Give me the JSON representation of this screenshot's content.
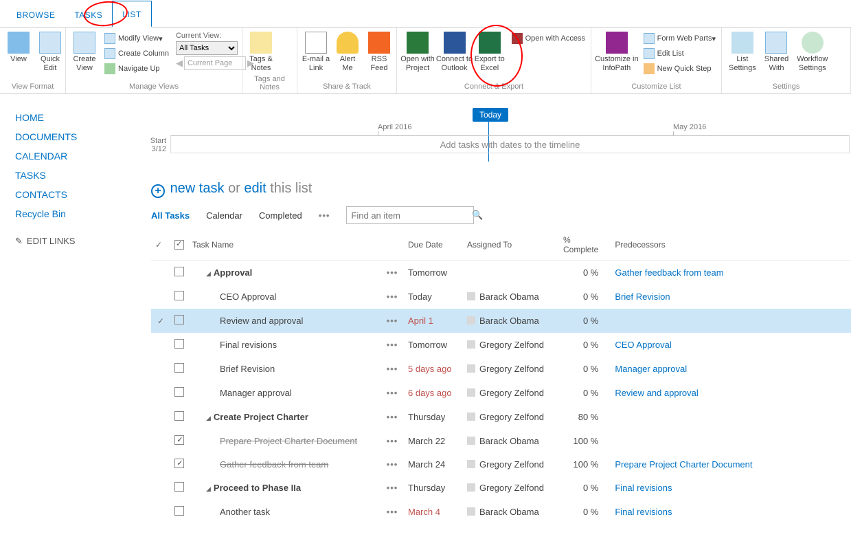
{
  "tabs": {
    "browse": "BROWSE",
    "tasks": "TASKS",
    "list": "LIST"
  },
  "ribbon": {
    "view_format": {
      "title": "View Format",
      "view": "View",
      "quick_edit": "Quick\nEdit"
    },
    "manage_views": {
      "title": "Manage Views",
      "create_view": "Create\nView",
      "modify_view": "Modify View",
      "create_column": "Create Column",
      "navigate_up": "Navigate Up",
      "current_view_lbl": "Current View:",
      "all_tasks": "All Tasks",
      "current_page": "Current Page"
    },
    "tags_notes": {
      "title": "Tags and Notes",
      "btn": "Tags &\nNotes"
    },
    "share_track": {
      "title": "Share & Track",
      "email": "E-mail a\nLink",
      "alert": "Alert\nMe",
      "rss": "RSS\nFeed"
    },
    "connect_export": {
      "title": "Connect & Export",
      "project": "Open with\nProject",
      "outlook": "Connect to\nOutlook",
      "excel": "Export to\nExcel",
      "access": "Open with Access"
    },
    "customize": {
      "title": "Customize List",
      "infopath": "Customize in\nInfoPath",
      "form_web_parts": "Form Web Parts",
      "edit_list": "Edit List",
      "new_quick_step": "New Quick Step"
    },
    "settings": {
      "title": "Settings",
      "list_settings": "List\nSettings",
      "shared_with": "Shared\nWith",
      "workflow": "Workflow\nSettings"
    }
  },
  "nav": {
    "home": "HOME",
    "documents": "DOCUMENTS",
    "calendar": "CALENDAR",
    "tasks": "TASKS",
    "contacts": "CONTACTS",
    "recycle": "Recycle Bin",
    "edit_links": "EDIT LINKS"
  },
  "timeline": {
    "today": "Today",
    "start": "Start",
    "start_date": "3/12",
    "month1": "April 2016",
    "month2": "May 2016",
    "placeholder": "Add tasks with dates to the timeline"
  },
  "newtask": {
    "new": "new task",
    "or": "or",
    "edit": "edit",
    "this_list": "this list"
  },
  "views": {
    "all": "All Tasks",
    "calendar": "Calendar",
    "completed": "Completed"
  },
  "search_placeholder": "Find an item",
  "cols": {
    "task_name": "Task Name",
    "due": "Due Date",
    "assigned": "Assigned To",
    "pct": "% Complete",
    "pred": "Predecessors"
  },
  "rows": [
    {
      "mark": false,
      "chk": false,
      "name": "Approval",
      "bold": true,
      "tri": true,
      "indent": 1,
      "due": "Tomorrow",
      "assigned": "",
      "pct": "0 %",
      "pred": "Gather feedback from team"
    },
    {
      "mark": false,
      "chk": false,
      "name": "CEO Approval",
      "indent": 2,
      "due": "Today",
      "assigned": "Barack Obama",
      "pct": "0 %",
      "pred": "Brief Revision"
    },
    {
      "mark": true,
      "chk": false,
      "name": "Review and approval",
      "indent": 2,
      "due": "April 1",
      "due_red": true,
      "assigned": "Barack Obama",
      "pct": "0 %",
      "pred": "",
      "sel": true
    },
    {
      "mark": false,
      "chk": false,
      "name": "Final revisions",
      "indent": 2,
      "due": "Tomorrow",
      "assigned": "Gregory Zelfond",
      "pct": "0 %",
      "pred": "CEO Approval"
    },
    {
      "mark": false,
      "chk": false,
      "name": "Brief Revision",
      "indent": 2,
      "due": "5 days ago",
      "due_red": true,
      "assigned": "Gregory Zelfond",
      "pct": "0 %",
      "pred": "Manager approval"
    },
    {
      "mark": false,
      "chk": false,
      "name": "Manager approval",
      "indent": 2,
      "due": "6 days ago",
      "due_red": true,
      "assigned": "Gregory Zelfond",
      "pct": "0 %",
      "pred": "Review and approval"
    },
    {
      "mark": false,
      "chk": false,
      "name": "Create Project Charter",
      "bold": true,
      "tri": true,
      "indent": 1,
      "due": "Thursday",
      "assigned": "Gregory Zelfond",
      "pct": "80 %",
      "pred": ""
    },
    {
      "mark": false,
      "chk": true,
      "name": "Prepare Project Charter Document",
      "strike": true,
      "indent": 2,
      "due": "March 22",
      "assigned": "Barack Obama",
      "pct": "100 %",
      "pred": ""
    },
    {
      "mark": false,
      "chk": true,
      "name": "Gather feedback from team",
      "strike": true,
      "indent": 2,
      "due": "March 24",
      "assigned": "Gregory Zelfond",
      "pct": "100 %",
      "pred": "Prepare Project Charter Document"
    },
    {
      "mark": false,
      "chk": false,
      "name": "Proceed to Phase IIa",
      "bold": true,
      "tri": true,
      "indent": 1,
      "due": "Thursday",
      "assigned": "Gregory Zelfond",
      "pct": "0 %",
      "pred": "Final revisions"
    },
    {
      "mark": false,
      "chk": false,
      "name": "Another task",
      "indent": 2,
      "due": "March 4",
      "due_red": true,
      "assigned": "Barack Obama",
      "pct": "0 %",
      "pred": "Final revisions"
    }
  ]
}
